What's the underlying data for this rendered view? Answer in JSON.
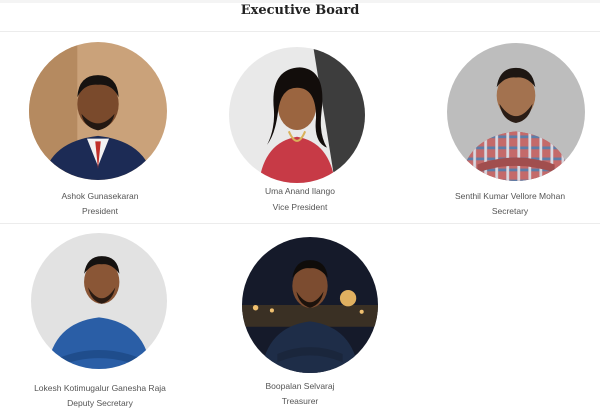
{
  "section": {
    "title": "Executive Board"
  },
  "members": [
    {
      "name": "Ashok Gunasekaran",
      "role": "President"
    },
    {
      "name": "Uma Anand Ilango",
      "role": "Vice President"
    },
    {
      "name": "Senthil Kumar Vellore Mohan",
      "role": "Secretary"
    },
    {
      "name": "Lokesh Kotimugalur Ganesha Raja",
      "role": "Deputy Secretary"
    },
    {
      "name": "Boopalan Selvaraj",
      "role": "Treasurer"
    }
  ],
  "colors": {
    "title": "#222222",
    "text": "#555555",
    "divider": "#ececec"
  }
}
